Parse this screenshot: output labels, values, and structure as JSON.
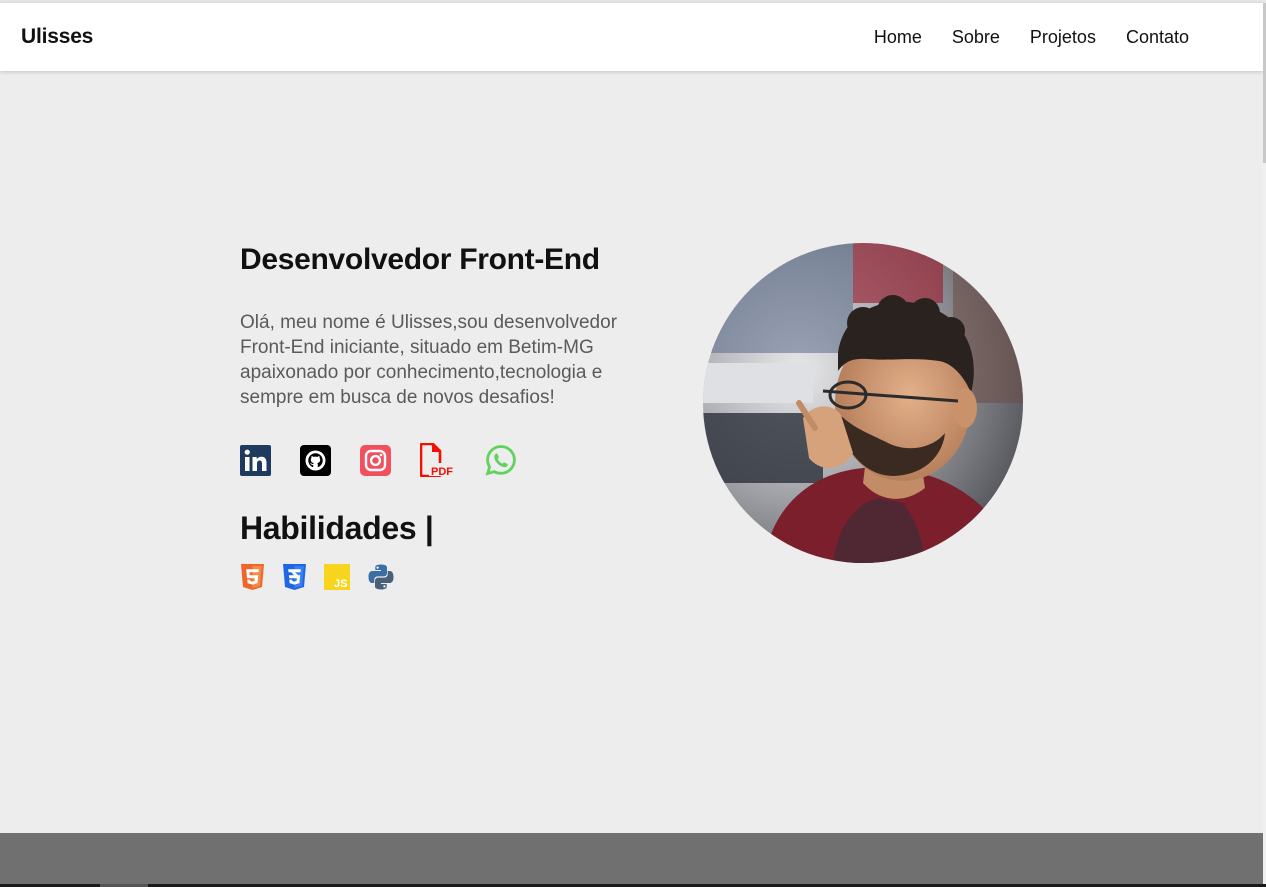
{
  "brand": "Ulisses",
  "nav": {
    "items": [
      "Home",
      "Sobre",
      "Projetos",
      "Contato"
    ]
  },
  "hero": {
    "title": "Desenvolvedor Front-End",
    "intro": "Olá, meu nome é Ulisses,sou desenvolvedor Front-End iniciante, situado em Betim-MG apaixonado por conhecimento,tecnologia e sempre em busca de novos desafios!"
  },
  "social": [
    {
      "icon": "linkedin-icon",
      "color": "#1f3a5f"
    },
    {
      "icon": "github-icon",
      "color": "#000000"
    },
    {
      "icon": "instagram-icon",
      "color": "#f1505d"
    },
    {
      "icon": "pdf-icon",
      "label": "PDF",
      "color": "#f40f02"
    },
    {
      "icon": "whatsapp-icon",
      "color": "#5fd35b"
    }
  ],
  "skills": {
    "title": "Habilidades |",
    "items": [
      {
        "icon": "html5-icon",
        "color": "#f06529"
      },
      {
        "icon": "css3-icon",
        "color": "#1f66e5"
      },
      {
        "icon": "javascript-icon",
        "label": "JS",
        "color": "#f7d51d"
      },
      {
        "icon": "python-icon",
        "color": "#3a6ea5"
      }
    ]
  },
  "colors": {
    "background": "#ededed",
    "navbar": "#ffffff",
    "footer": "#707070",
    "text": "#111111",
    "muted_text": "#5a5a5a"
  }
}
